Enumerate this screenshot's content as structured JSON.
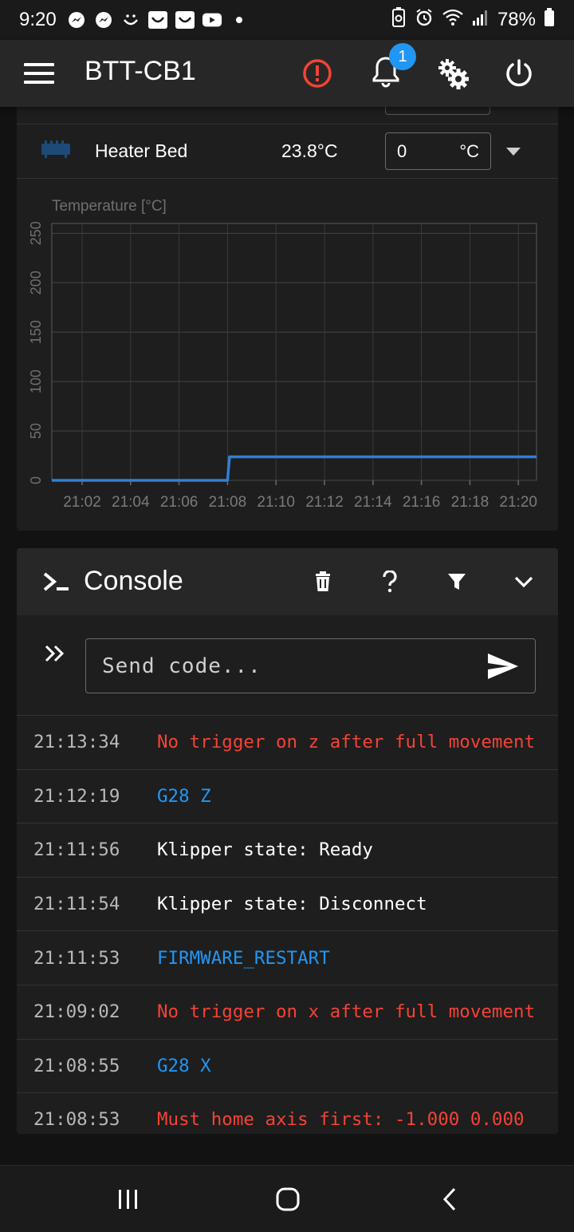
{
  "status_bar": {
    "time": "9:20",
    "battery": "78%",
    "left_icons": [
      "messenger-icon",
      "messenger-icon",
      "smiley-icon",
      "app-icon",
      "app-icon",
      "youtube-icon",
      "dot-icon"
    ],
    "right_icons": [
      "battery-saver-icon",
      "alarm-icon",
      "wifi-icon",
      "signal-icon",
      "battery-icon"
    ]
  },
  "appbar": {
    "title": "BTT-CB1",
    "notification_count": "1",
    "error_color": "#f44336",
    "badge_color": "#2196f3"
  },
  "heater": {
    "name": "Heater Bed",
    "current": "23.8°C",
    "target_value": "0",
    "target_unit": "°C",
    "icon": "heater-bed-icon",
    "icon_color": "#1e4a7a"
  },
  "chart_data": {
    "type": "line",
    "title": "Temperature [°C]",
    "xlabel": "",
    "ylabel": "Temperature [°C]",
    "x_ticks": [
      "21:02",
      "21:04",
      "21:06",
      "21:08",
      "21:10",
      "21:12",
      "21:14",
      "21:16",
      "21:18",
      "21:20"
    ],
    "y_ticks": [
      "0",
      "50",
      "100",
      "150",
      "200",
      "250"
    ],
    "xlim": [
      "21:00:45",
      "21:20:45"
    ],
    "ylim": [
      0,
      260
    ],
    "grid": true,
    "series": [
      {
        "color": "#2f7fd8",
        "x": [
          "21:00:45",
          "21:08:00",
          "21:08:05",
          "21:20:45"
        ],
        "y": [
          0,
          0,
          23.8,
          23.8
        ]
      }
    ]
  },
  "console": {
    "title": "Console",
    "input_placeholder": "Send code...",
    "entries": [
      {
        "time": "21:13:34",
        "message": "No trigger on z after full movement",
        "kind": "error"
      },
      {
        "time": "21:12:19",
        "message": "G28 Z",
        "kind": "command"
      },
      {
        "time": "21:11:56",
        "message": "Klipper state: Ready",
        "kind": "info"
      },
      {
        "time": "21:11:54",
        "message": "Klipper state: Disconnect",
        "kind": "info"
      },
      {
        "time": "21:11:53",
        "message": "FIRMWARE_RESTART",
        "kind": "command"
      },
      {
        "time": "21:09:02",
        "message": "No trigger on x after full movement",
        "kind": "error"
      },
      {
        "time": "21:08:55",
        "message": "G28 X",
        "kind": "command"
      },
      {
        "time": "21:08:53",
        "message": "Must home axis first: -1.000 0.000",
        "kind": "error"
      }
    ]
  },
  "nav": {
    "icons": [
      "recent-apps-icon",
      "home-icon",
      "back-icon"
    ]
  }
}
